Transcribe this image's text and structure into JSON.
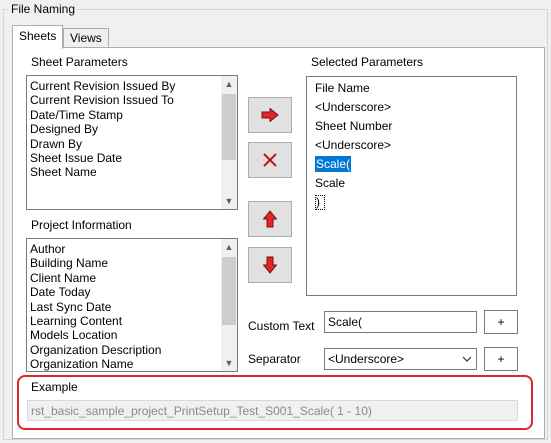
{
  "window": {
    "group_title": "File Naming",
    "tabs": [
      {
        "label": "Sheets",
        "active": true
      },
      {
        "label": "Views",
        "active": false
      }
    ]
  },
  "sheet_parameters": {
    "label": "Sheet Parameters",
    "items": [
      "Current Revision Issued By",
      "Current Revision Issued To",
      "Date/Time Stamp",
      "Designed By",
      "Drawn By",
      "Sheet Issue Date",
      "Sheet Name"
    ]
  },
  "project_information": {
    "label": "Project Information",
    "items": [
      "Author",
      "Building Name",
      "Client Name",
      "Date Today",
      "Last Sync Date",
      "Learning Content",
      "Models Location",
      "Organization Description",
      "Organization Name"
    ]
  },
  "selected_parameters": {
    "label": "Selected Parameters",
    "items": [
      {
        "text": "File Name",
        "selected": false
      },
      {
        "text": "<Underscore>",
        "selected": false
      },
      {
        "text": "Sheet Number",
        "selected": false
      },
      {
        "text": "<Underscore>",
        "selected": false
      },
      {
        "text": "Scale(",
        "selected": true
      },
      {
        "text": "Scale",
        "selected": false
      },
      {
        "text": ")",
        "selected": false,
        "focused": true
      }
    ]
  },
  "buttons": {
    "add_icon": "arrow-right-icon",
    "remove_icon": "x-icon",
    "move_up_icon": "arrow-up-icon",
    "move_down_icon": "arrow-down-icon",
    "plus_label": "+"
  },
  "custom_text": {
    "label": "Custom Text",
    "value": "Scale("
  },
  "separator": {
    "label": "Separator",
    "value": "<Underscore>"
  },
  "example": {
    "label": "Example",
    "value": "rst_basic_sample_project_PrintSetup_Test_S001_Scale( 1 - 10)"
  },
  "colors": {
    "accent_red": "#e0262a",
    "selection_blue": "#0078d7"
  }
}
